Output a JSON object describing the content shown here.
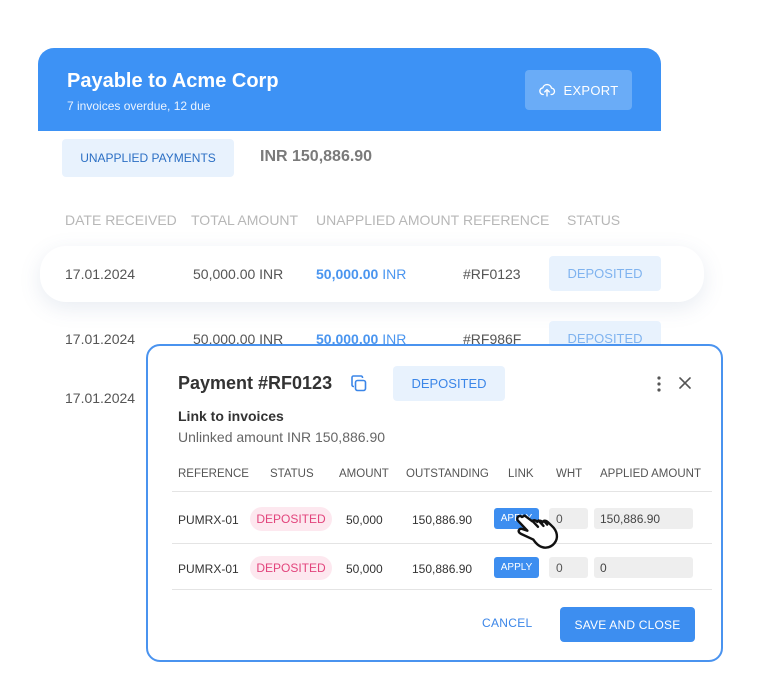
{
  "header": {
    "title": "Payable to Acme Corp",
    "subtitle": "7 invoices overdue, 12 due",
    "export_label": "EXPORT",
    "export_icon": "cloud-upload-icon",
    "color": "#3d92f5"
  },
  "summary": {
    "tab_label": "UNAPPLIED PAYMENTS",
    "total": "INR 150,886.90"
  },
  "payments_table": {
    "columns": [
      "DATE RECEIVED",
      "TOTAL AMOUNT",
      "UNAPPLIED AMOUNT",
      "REFERENCE",
      "STATUS"
    ],
    "rows": [
      {
        "date": "17.01.2024",
        "total": "50,000.00 INR",
        "unapplied_value": "50,000.00",
        "unapplied_unit": "INR",
        "reference": "#RF0123",
        "status": "DEPOSITED"
      },
      {
        "date": "17.01.2024",
        "total": "50,000.00 INR",
        "unapplied_value": "50,000.00",
        "unapplied_unit": "INR",
        "reference": "#RF986F",
        "status": "DEPOSITED"
      },
      {
        "date": "17.01.2024"
      }
    ]
  },
  "modal": {
    "title": "Payment #RF0123",
    "status": "DEPOSITED",
    "link_heading": "Link to invoices",
    "unlinked": "Unlinked amount INR 150,886.90",
    "columns": [
      "REFERENCE",
      "STATUS",
      "AMOUNT",
      "OUTSTANDING",
      "LINK",
      "WHT",
      "APPLIED AMOUNT"
    ],
    "rows": [
      {
        "reference": "PUMRX-01",
        "status": "DEPOSITED",
        "amount": "50,000",
        "outstanding": "150,886.90",
        "link": "APPLY",
        "wht": "0",
        "applied": "150,886.90"
      },
      {
        "reference": "PUMRX-01",
        "status": "DEPOSITED",
        "amount": "50,000",
        "outstanding": "150,886.90",
        "link": "APPLY",
        "wht": "0",
        "applied": "0"
      }
    ],
    "cancel_label": "CANCEL",
    "save_label": "SAVE AND CLOSE",
    "accent": "#3d8ef0",
    "status_color": "#e2447c"
  }
}
